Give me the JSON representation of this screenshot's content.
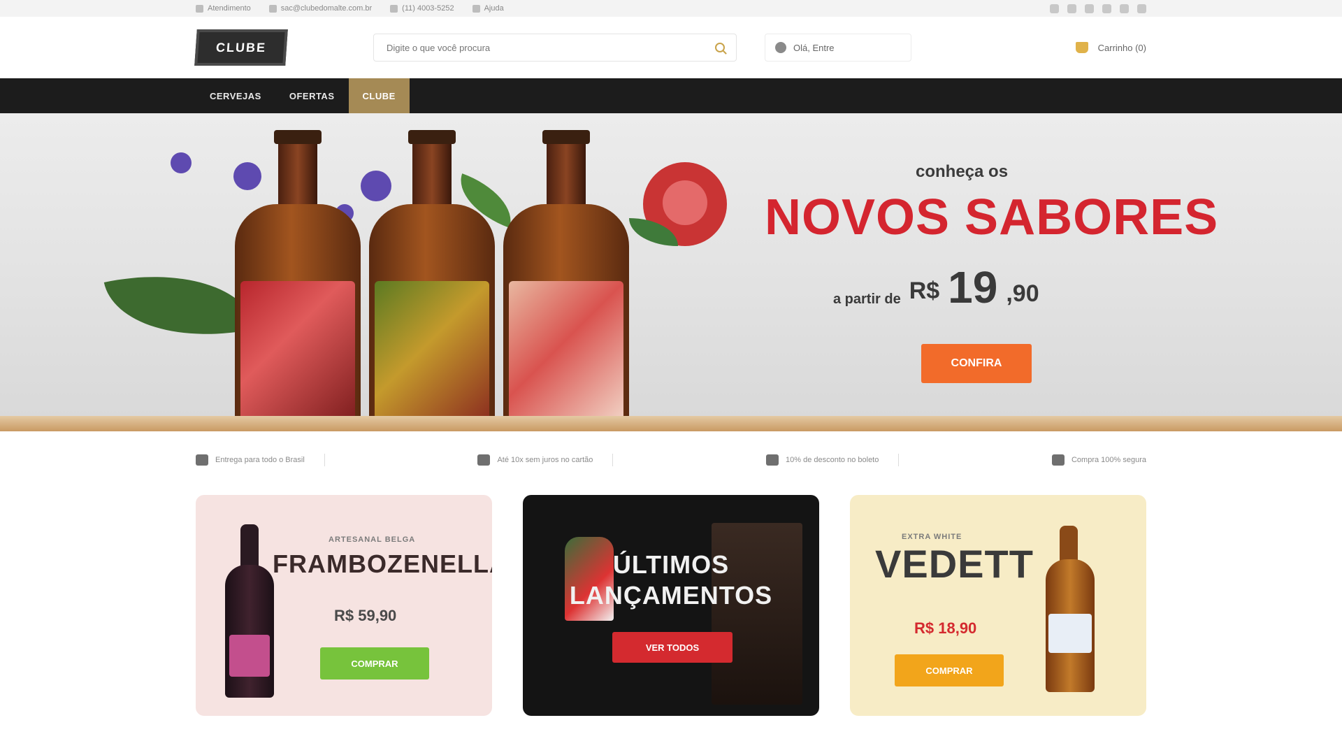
{
  "topbar": {
    "links": [
      {
        "label": "Atendimento",
        "icon": "phone-icon"
      },
      {
        "label": "sac@clubedomalte.com.br",
        "icon": "mail-icon"
      },
      {
        "label": "(11) 4003-5252",
        "icon": "whatsapp-icon"
      },
      {
        "label": "Ajuda",
        "icon": "help-icon"
      }
    ],
    "socials": [
      "facebook-icon",
      "instagram-icon",
      "twitter-icon",
      "youtube-icon",
      "pinterest-icon",
      "blog-icon"
    ]
  },
  "header": {
    "logo_text": "CLUBE",
    "search_placeholder": "Digite o que você procura",
    "account_label": "Olá, Entre",
    "cart_label": "Carrinho (0)"
  },
  "nav": {
    "items": [
      {
        "label": "Cervejas",
        "active": false
      },
      {
        "label": "Ofertas",
        "active": false
      },
      {
        "label": "Clube",
        "active": true
      }
    ]
  },
  "hero": {
    "pretitle": "conheça os",
    "title": "NOVOS SABORES",
    "price_prefix": "a partir de",
    "currency": "R$",
    "price": "19",
    "price_cents": ",90",
    "button": "CONFIRA"
  },
  "benefits": [
    {
      "label": "Entrega para todo o Brasil",
      "icon": "truck-icon"
    },
    {
      "label": "Até 10x sem juros no cartão",
      "icon": "card-icon"
    },
    {
      "label": "10% de desconto no boleto",
      "icon": "barcode-icon"
    },
    {
      "label": "Compra 100% segura",
      "icon": "lock-icon"
    }
  ],
  "promos": [
    {
      "small": "ARTESANAL BELGA",
      "title": "FRAMBOZENELLA",
      "price": "R$ 59,90",
      "button": "COMPRAR",
      "accent": "#77c33c"
    },
    {
      "small": "",
      "title": "ÚLTIMOS LANÇAMENTOS",
      "price": "",
      "button": "VER TODOS",
      "accent": "#d42a2f"
    },
    {
      "small": "EXTRA WHITE",
      "title": "VEDETT",
      "price": "R$ 18,90",
      "button": "COMPRAR",
      "accent": "#f2a51b"
    }
  ]
}
